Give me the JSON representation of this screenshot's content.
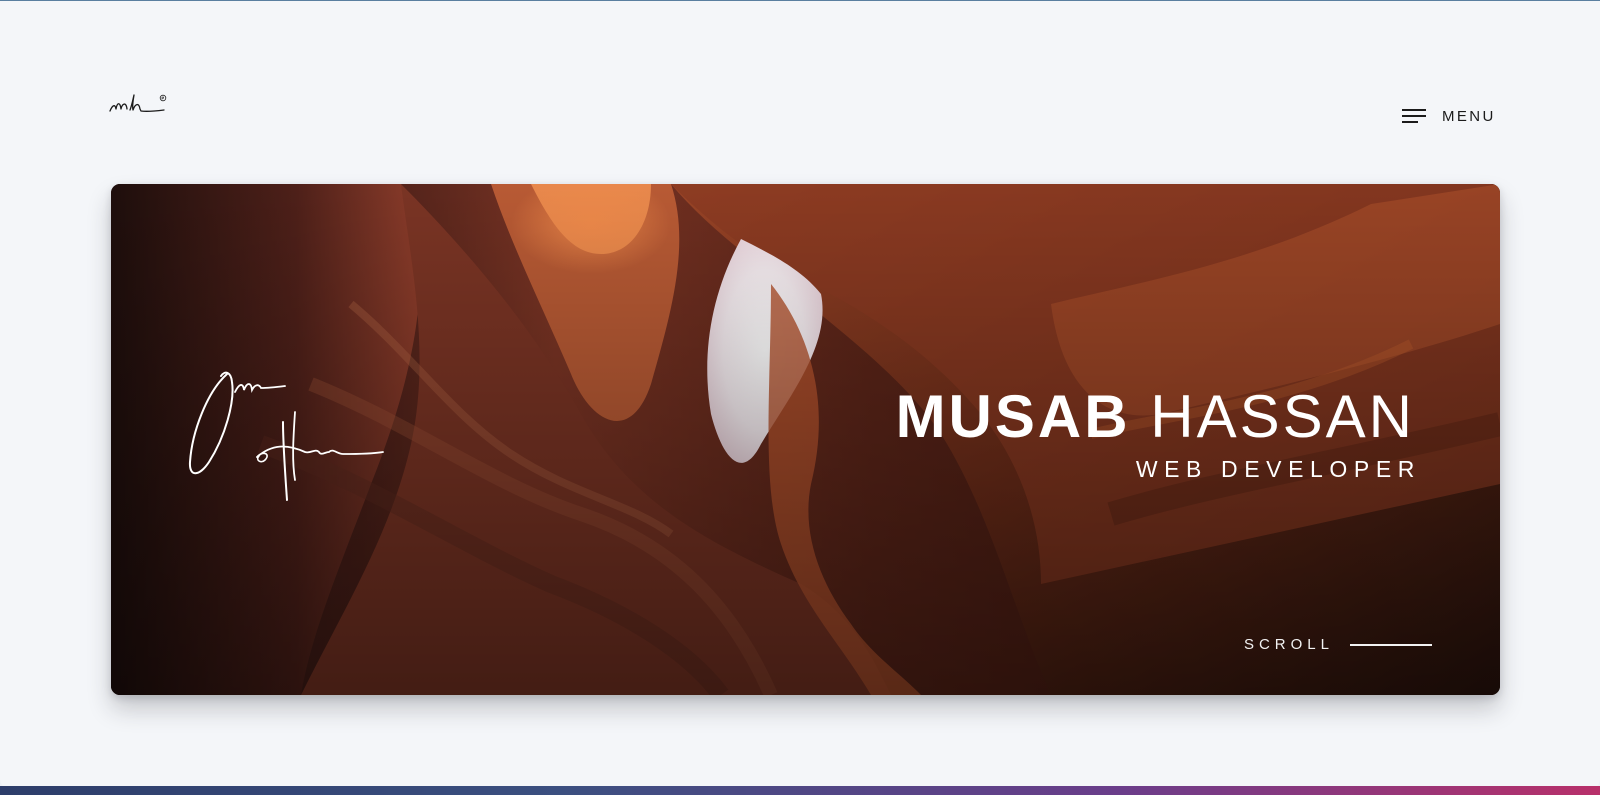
{
  "header": {
    "logo_icon": "mh-signature-logo-icon",
    "menu_icon": "hamburger-menu-icon",
    "menu_label": "MENU"
  },
  "hero": {
    "background": "canyon-rock-photo",
    "signature_icon": "handwritten-signature-icon",
    "first_name": "MUSAB",
    "last_name": "HASSAN",
    "role": "WEB DEVELOPER",
    "scroll_label": "SCROLL"
  },
  "colors": {
    "page_background": "#f4f6f9",
    "text_dark": "#1b1b1b",
    "hero_text": "#ffffff"
  }
}
